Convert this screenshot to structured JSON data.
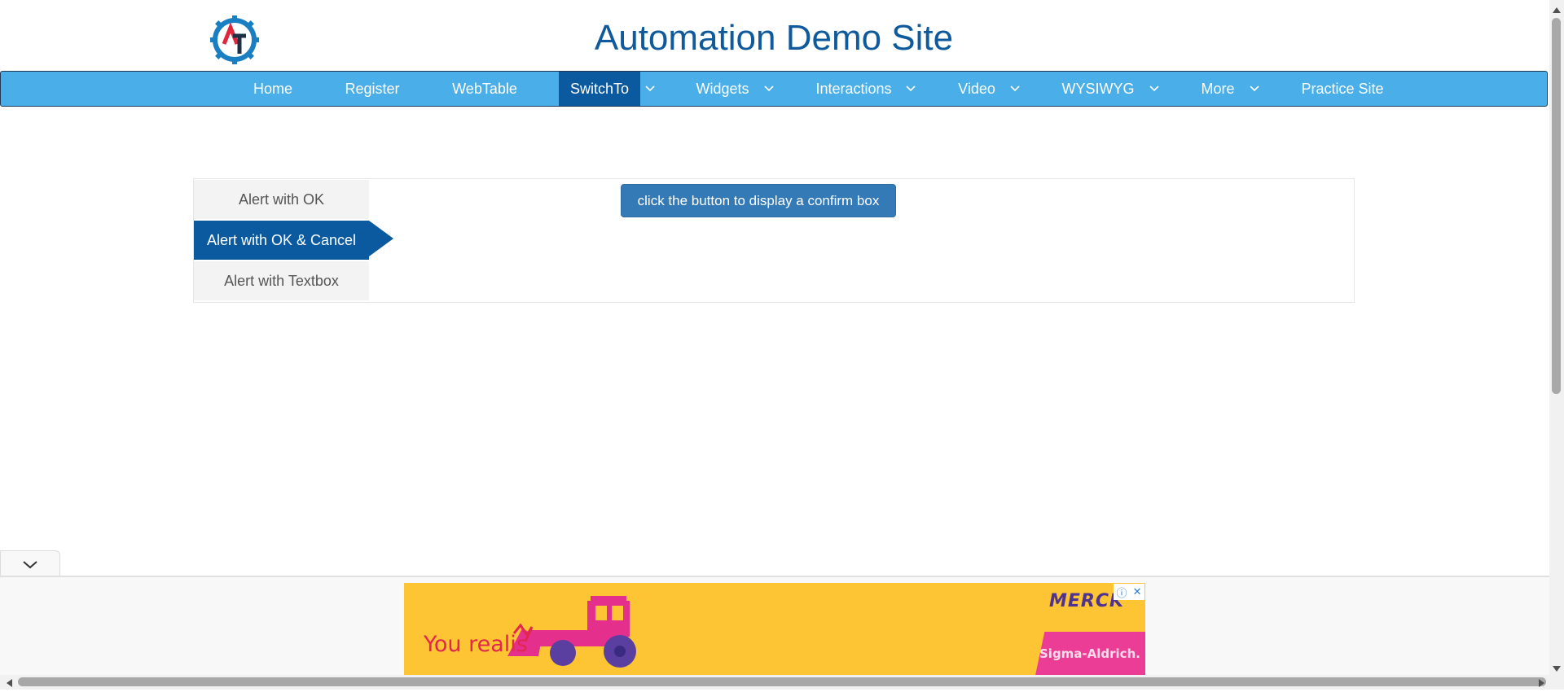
{
  "site": {
    "title": "Automation Demo Site"
  },
  "nav": {
    "items": [
      {
        "label": "Home"
      },
      {
        "label": "Register"
      },
      {
        "label": "WebTable"
      },
      {
        "label": "SwitchTo",
        "active": true
      },
      {
        "label": "Widgets"
      },
      {
        "label": "Interactions"
      },
      {
        "label": "Video"
      },
      {
        "label": "WYSIWYG"
      },
      {
        "label": "More"
      },
      {
        "label": "Practice Site"
      }
    ]
  },
  "tabs": [
    {
      "label": "Alert with OK"
    },
    {
      "label": "Alert with OK & Cancel",
      "active": true
    },
    {
      "label": "Alert with Textbox"
    }
  ],
  "confirm_button": {
    "label": "click the button to display a confirm box"
  },
  "ad": {
    "text": "You realis",
    "brand": "MERCK",
    "sub_brand": "Sigma-Aldrich."
  },
  "colors": {
    "nav_bg": "#4aaee8",
    "nav_active": "#0b5aa0",
    "title": "#0e5a9c",
    "button": "#337ab7",
    "ad_bg": "#fdc533"
  }
}
